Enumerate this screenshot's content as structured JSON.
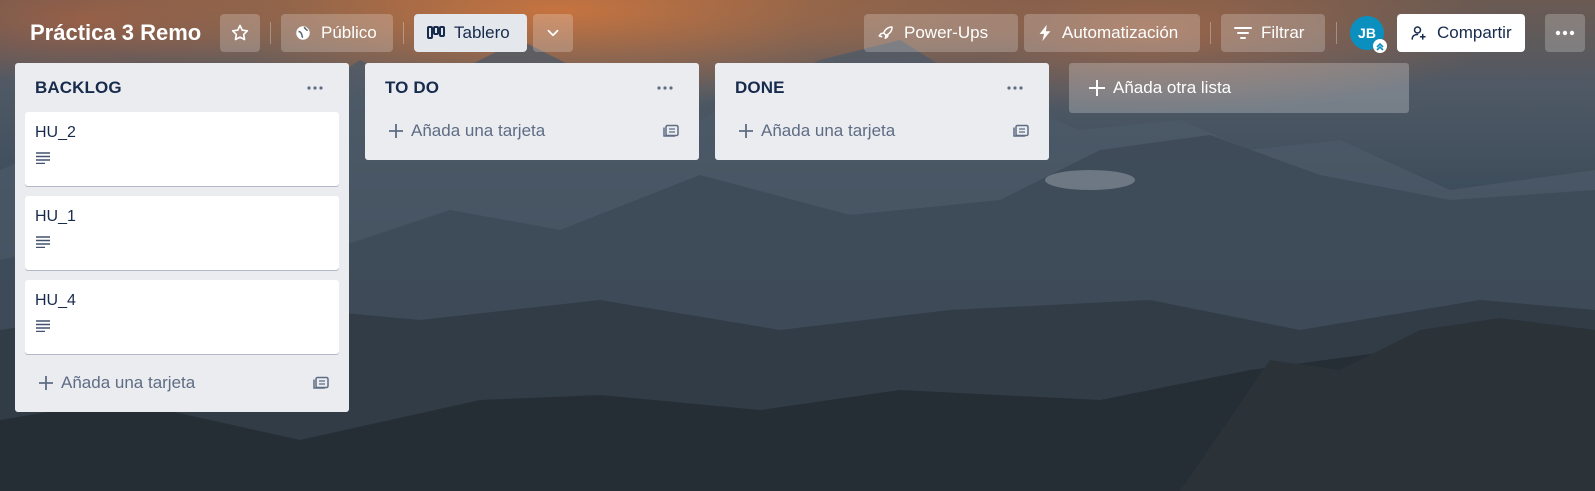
{
  "header": {
    "board_title": "Práctica 3 Remo",
    "star_icon": "star-icon",
    "visibility_label": "Público",
    "view_label": "Tablero",
    "powerups_label": "Power-Ups",
    "automation_label": "Automatización",
    "filter_label": "Filtrar",
    "avatar_initials": "JB",
    "share_label": "Compartir"
  },
  "lists": [
    {
      "title": "BACKLOG",
      "cards": [
        {
          "title": "HU_2"
        },
        {
          "title": "HU_1"
        },
        {
          "title": "HU_4"
        }
      ],
      "add_card_label": "Añada una tarjeta"
    },
    {
      "title": "TO DO",
      "cards": [],
      "add_card_label": "Añada una tarjeta"
    },
    {
      "title": "DONE",
      "cards": [],
      "add_card_label": "Añada una tarjeta"
    }
  ],
  "add_list_label": "Añada otra lista",
  "colors": {
    "list_bg": "#ebecf0",
    "text_primary": "#172b4d",
    "text_secondary": "#5e6c84",
    "avatar_bg": "#0a8fbf"
  }
}
